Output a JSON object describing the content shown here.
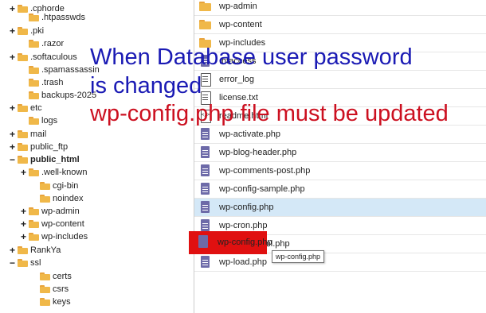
{
  "colors": {
    "caption_blue": "#1a1ab4",
    "caption_red": "#cc1020",
    "highlight_red": "#e01010",
    "selected_row": "#d4e8f7",
    "folder": "#f0b849",
    "php_icon": "#6d6aa8"
  },
  "tree": {
    "items": [
      {
        "label": ".cphorde",
        "toggle": "+",
        "bold": false
      },
      {
        "label": ".htpasswds",
        "toggle": "",
        "bold": false
      },
      {
        "label": ".pki",
        "toggle": "+",
        "bold": false
      },
      {
        "label": ".razor",
        "toggle": "",
        "bold": false
      },
      {
        "label": ".softaculous",
        "toggle": "+",
        "bold": false
      },
      {
        "label": ".spamassassin",
        "toggle": "",
        "bold": false
      },
      {
        "label": ".trash",
        "toggle": "",
        "bold": false
      },
      {
        "label": "backups-2025",
        "toggle": "",
        "bold": false
      },
      {
        "label": "etc",
        "toggle": "+",
        "bold": false
      },
      {
        "label": "logs",
        "toggle": "",
        "bold": false
      },
      {
        "label": "mail",
        "toggle": "+",
        "bold": false
      },
      {
        "label": "public_ftp",
        "toggle": "+",
        "bold": false
      },
      {
        "label": "public_html",
        "toggle": "−",
        "bold": true
      },
      {
        "label": ".well-known",
        "toggle": "+",
        "bold": false
      },
      {
        "label": "cgi-bin",
        "toggle": "",
        "bold": false
      },
      {
        "label": "noindex",
        "toggle": "",
        "bold": false
      },
      {
        "label": "wp-admin",
        "toggle": "+",
        "bold": false
      },
      {
        "label": "wp-content",
        "toggle": "+",
        "bold": false
      },
      {
        "label": "wp-includes",
        "toggle": "+",
        "bold": false
      },
      {
        "label": "RankYa",
        "toggle": "+",
        "bold": false
      },
      {
        "label": "ssl",
        "toggle": "−",
        "bold": false
      },
      {
        "label": "certs",
        "toggle": "",
        "bold": false
      },
      {
        "label": "csrs",
        "toggle": "",
        "bold": false
      },
      {
        "label": "keys",
        "toggle": "",
        "bold": false
      }
    ]
  },
  "files": [
    {
      "name": "wp-admin",
      "icon": "folder"
    },
    {
      "name": "wp-content",
      "icon": "folder"
    },
    {
      "name": "wp-includes",
      "icon": "folder"
    },
    {
      "name": ".htaccess",
      "icon": "php"
    },
    {
      "name": "error_log",
      "icon": "txt"
    },
    {
      "name": "license.txt",
      "icon": "txt"
    },
    {
      "name": "readme.html",
      "icon": "html"
    },
    {
      "name": "wp-activate.php",
      "icon": "php"
    },
    {
      "name": "wp-blog-header.php",
      "icon": "php"
    },
    {
      "name": "wp-comments-post.php",
      "icon": "php"
    },
    {
      "name": "wp-config-sample.php",
      "icon": "php"
    },
    {
      "name": "wp-config.php",
      "icon": "php"
    },
    {
      "name": "wp-cron.php",
      "icon": "php"
    },
    {
      "name": "wp-links-opml.php",
      "icon": "php"
    },
    {
      "name": "wp-load.php",
      "icon": "php"
    }
  ],
  "tooltip": "wp-config.php",
  "caption": {
    "line1": "When Database user password",
    "line2": "is changed",
    "line3": "wp-config.php file must be updated"
  }
}
